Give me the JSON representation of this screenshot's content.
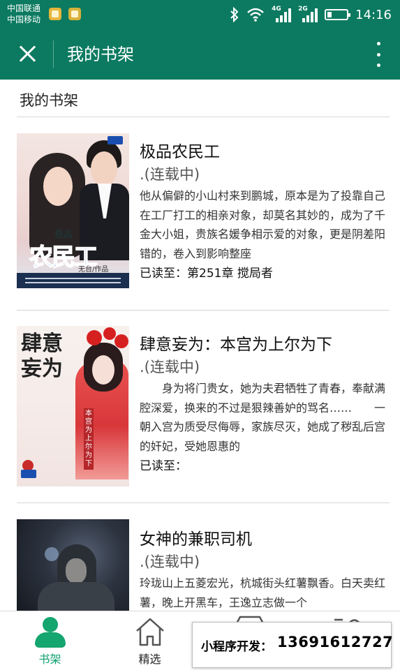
{
  "status_bar": {
    "carrier_1": "中国联通",
    "carrier_2": "中国移动",
    "network_1": "4G",
    "network_2": "2G",
    "time": "14:16"
  },
  "nav": {
    "title": "我的书架",
    "close_icon": "close-icon",
    "more_icon": "more-vertical-icon",
    "bar_color": "#0b7a60"
  },
  "shelf": {
    "header": "我的书架",
    "books": [
      {
        "title": "极品农民工",
        "status": ".(连载中)",
        "description": "他从偏僻的小山村来到鹏城，原本是为了投靠自己在工厂打工的相亲对象，却莫名其妙的，成为了千金大小姐，贵族名媛争相示爱的对象，更是阴差阳错的，卷入到影响整座",
        "progress": "已读至：第251章 搅局者",
        "cover": {
          "small_title": "极品",
          "big_title": "农民工",
          "author": "无台/作品"
        }
      },
      {
        "title": "肆意妄为：本宫为上尔为下",
        "status": ".(连载中)",
        "description": "　　身为将门贵女，她为夫君牺牲了青春，奉献满腔深爱，换来的不过是狠辣善妒的骂名……　　一朝入宫为质受尽侮辱，家族尽灭，她成了秽乱后宫的奸妃，受她恩惠的",
        "progress": "已读至：",
        "cover": {
          "calligraphy": "肆意妄为",
          "vertical_title": "本宫为上尔为下"
        }
      },
      {
        "title": "女神的兼职司机",
        "status": ".(连载中)",
        "description": "玲珑山上五菱宏光，杭城街头红薯飘香。白天卖红薯，晚上开黑车，王逸立志做一个",
        "progress": "",
        "cover": {}
      }
    ]
  },
  "tabs": [
    {
      "label": "书架",
      "icon": "person-icon",
      "active": true
    },
    {
      "label": "精选",
      "icon": "home-icon",
      "active": false
    }
  ],
  "promo": {
    "label": "小程序开发：",
    "phone": "13691612727"
  },
  "colors": {
    "primary": "#0b7a60",
    "active_tab": "#10a06d"
  }
}
